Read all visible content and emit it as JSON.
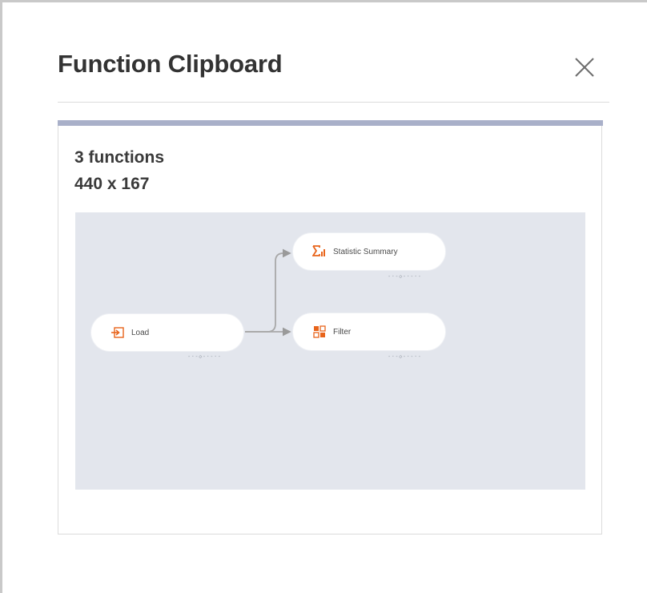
{
  "dialog": {
    "title": "Function Clipboard",
    "close_icon": "close-icon"
  },
  "clipboard_item": {
    "function_count": "3 functions",
    "dimensions": "440 x 167",
    "accent_color": "#a9b0c9",
    "preview_background": "#e3e6ed",
    "nodes": [
      {
        "label": "Load",
        "icon": "load-icon",
        "icon_color": "#e8641b"
      },
      {
        "label": "Statistic Summary",
        "icon": "statistic-summary-icon",
        "icon_color": "#e8641b"
      },
      {
        "label": "Filter",
        "icon": "filter-icon",
        "icon_color": "#e8641b"
      }
    ],
    "port_marker": "-·-◇-·-·-"
  }
}
